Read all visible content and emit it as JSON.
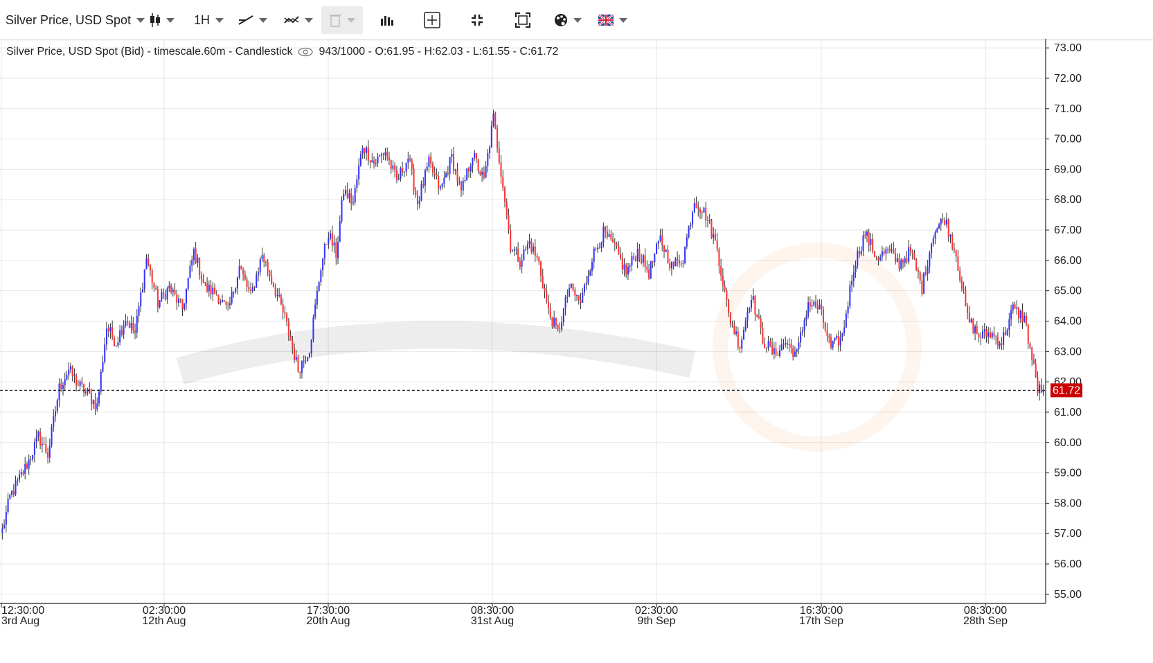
{
  "toolbar": {
    "symbol_label": "Silver Price, USD Spot",
    "interval_label": "1H",
    "items": [
      {
        "name": "chart-type-button",
        "icon": "candlestick-icon"
      },
      {
        "name": "interval-button",
        "icon": "none"
      },
      {
        "name": "draw-line-button",
        "icon": "trend-line-icon"
      },
      {
        "name": "indicators-button",
        "icon": "indicator-icon"
      },
      {
        "name": "delete-button",
        "icon": "trash-icon",
        "disabled": true
      },
      {
        "name": "volume-button",
        "icon": "bar-chart-icon"
      },
      {
        "name": "crosshair-button",
        "icon": "crosshair-icon"
      },
      {
        "name": "fullscreen-button",
        "icon": "fullscreen-icon"
      },
      {
        "name": "zoom-fit-button",
        "icon": "frame-icon"
      },
      {
        "name": "theme-button",
        "icon": "palette-icon"
      },
      {
        "name": "language-button",
        "icon": "uk-flag-icon"
      }
    ]
  },
  "legend": {
    "title": "Silver Price, USD Spot (Bid) - timescale.60m - Candlestick",
    "stats": "943/1000 - O:61.95 - H:62.03 - L:61.55 - C:61.72"
  },
  "colors": {
    "up": "#3333ff",
    "down": "#ff3333",
    "wick": "#333333",
    "grid": "#e6e6e6",
    "price_tag": "#cc0000"
  },
  "chart_data": {
    "type": "candlestick",
    "title": "Silver Price, USD Spot (Bid) - timescale.60m - Candlestick",
    "y_ticks": [
      "73.00",
      "72.00",
      "71.00",
      "70.00",
      "69.00",
      "68.00",
      "67.00",
      "66.00",
      "65.00",
      "64.00",
      "63.00",
      "62.00",
      "61.00",
      "60.00",
      "59.00",
      "58.00",
      "57.00",
      "56.00",
      "55.00"
    ],
    "ylim": [
      54.7,
      73.3
    ],
    "x_ticks": [
      {
        "time": "12:30:00",
        "date": "3rd Aug"
      },
      {
        "time": "02:30:00",
        "date": "12th Aug"
      },
      {
        "time": "17:30:00",
        "date": "20th Aug"
      },
      {
        "time": "08:30:00",
        "date": "31st Aug"
      },
      {
        "time": "02:30:00",
        "date": "9th Sep"
      },
      {
        "time": "16:30:00",
        "date": "17th Sep"
      },
      {
        "time": "08:30:00",
        "date": "28th Sep"
      }
    ],
    "last_price": 61.72,
    "last_price_label": "61.72",
    "grid": true,
    "series": [
      {
        "close_path": [
          [
            0,
            57.1
          ],
          [
            4,
            58.2
          ],
          [
            9,
            58.8
          ],
          [
            14,
            59.4
          ],
          [
            19,
            60.2
          ],
          [
            24,
            59.6
          ],
          [
            30,
            61.8
          ],
          [
            35,
            62.4
          ],
          [
            40,
            61.9
          ],
          [
            45,
            61.6
          ],
          [
            50,
            61.2
          ],
          [
            55,
            63.8
          ],
          [
            60,
            63.3
          ],
          [
            65,
            64.1
          ],
          [
            70,
            63.6
          ],
          [
            76,
            66.1
          ],
          [
            82,
            64.6
          ],
          [
            88,
            65.1
          ],
          [
            95,
            64.4
          ],
          [
            101,
            66.3
          ],
          [
            107,
            65.1
          ],
          [
            113,
            64.9
          ],
          [
            119,
            64.3
          ],
          [
            125,
            65.8
          ],
          [
            131,
            64.8
          ],
          [
            137,
            66.2
          ],
          [
            143,
            65.2
          ],
          [
            149,
            64.1
          ],
          [
            156,
            62.4
          ],
          [
            162,
            63.1
          ],
          [
            168,
            65.8
          ],
          [
            172,
            66.9
          ],
          [
            176,
            66.2
          ],
          [
            180,
            68.3
          ],
          [
            185,
            67.9
          ],
          [
            190,
            69.8
          ],
          [
            196,
            69.2
          ],
          [
            202,
            69.6
          ],
          [
            208,
            68.6
          ],
          [
            214,
            69.4
          ],
          [
            219,
            67.9
          ],
          [
            225,
            69.2
          ],
          [
            231,
            68.3
          ],
          [
            237,
            69.4
          ],
          [
            242,
            68.2
          ],
          [
            248,
            69.5
          ],
          [
            254,
            68.6
          ],
          [
            259,
            70.7
          ],
          [
            264,
            68.5
          ],
          [
            268,
            66.5
          ],
          [
            273,
            66.0
          ],
          [
            278,
            66.6
          ],
          [
            283,
            65.9
          ],
          [
            288,
            64.3
          ],
          [
            293,
            63.6
          ],
          [
            299,
            65.1
          ],
          [
            305,
            64.6
          ],
          [
            311,
            66.1
          ],
          [
            317,
            66.9
          ],
          [
            323,
            66.4
          ],
          [
            329,
            65.6
          ],
          [
            335,
            66.3
          ],
          [
            341,
            65.6
          ],
          [
            347,
            66.7
          ],
          [
            353,
            65.8
          ],
          [
            359,
            66.1
          ],
          [
            365,
            68.0
          ],
          [
            371,
            67.5
          ],
          [
            377,
            66.4
          ],
          [
            383,
            64.2
          ],
          [
            389,
            63.2
          ],
          [
            395,
            64.9
          ],
          [
            401,
            63.4
          ],
          [
            407,
            62.9
          ],
          [
            413,
            63.3
          ],
          [
            419,
            62.9
          ],
          [
            425,
            64.6
          ],
          [
            431,
            64.4
          ],
          [
            437,
            63.1
          ],
          [
            443,
            63.5
          ],
          [
            449,
            65.8
          ],
          [
            455,
            66.9
          ],
          [
            461,
            66.1
          ],
          [
            467,
            66.3
          ],
          [
            473,
            65.9
          ],
          [
            479,
            66.3
          ],
          [
            485,
            65.1
          ],
          [
            491,
            66.9
          ],
          [
            497,
            67.4
          ],
          [
            503,
            66.2
          ],
          [
            509,
            64.1
          ],
          [
            515,
            63.5
          ],
          [
            521,
            63.6
          ],
          [
            527,
            63.3
          ],
          [
            533,
            64.4
          ],
          [
            539,
            64.1
          ],
          [
            546,
            61.75
          ]
        ]
      }
    ]
  }
}
